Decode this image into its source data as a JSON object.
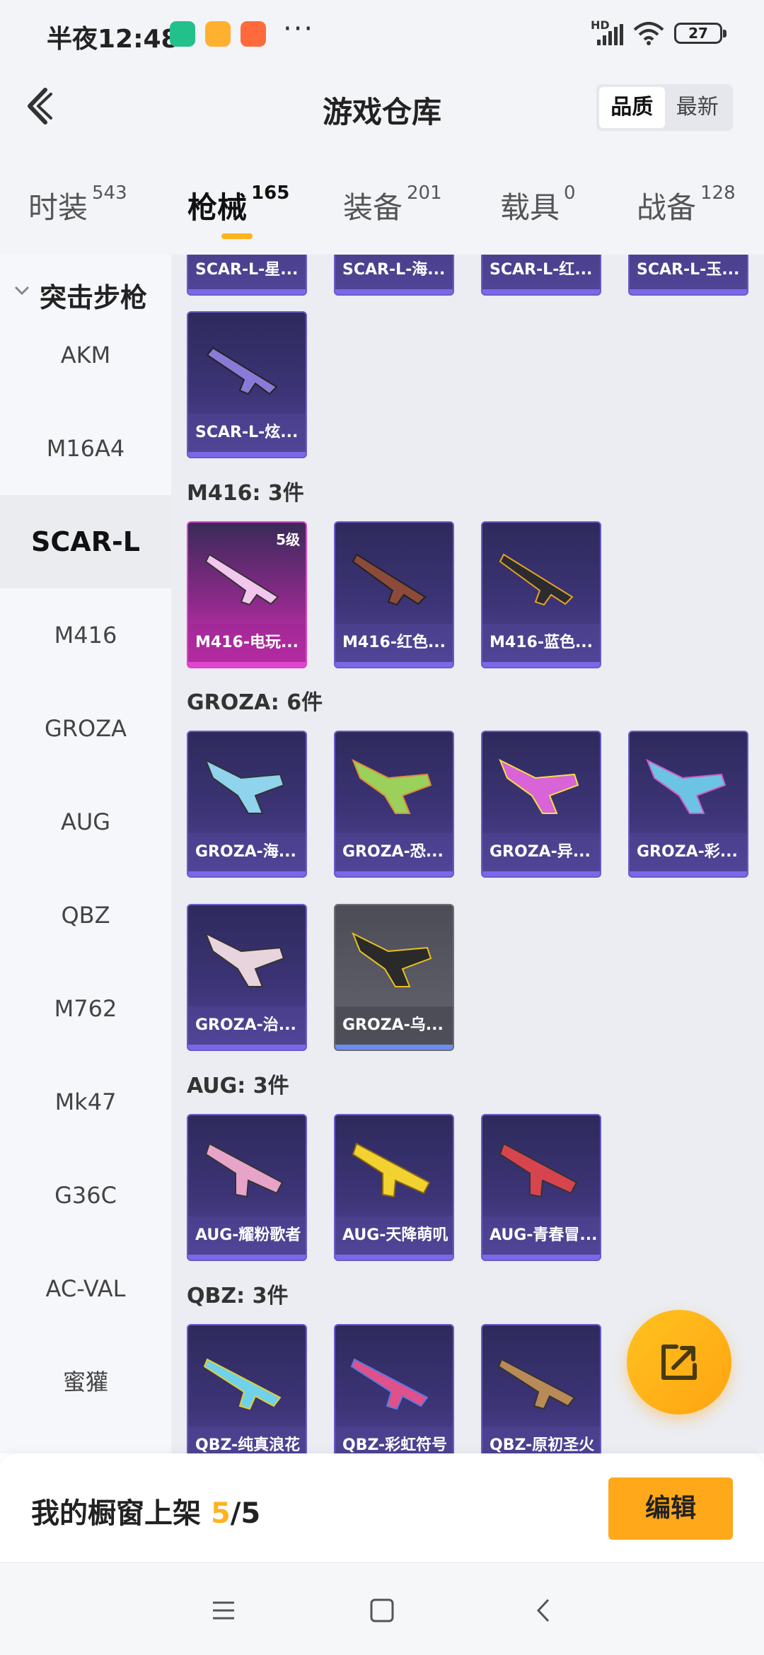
{
  "status_bar": {
    "time": "半夜12:48",
    "more": "···",
    "network_label": "HD",
    "battery": "27",
    "app_icons": [
      {
        "name": "shield-app-icon",
        "color": "#22c08a"
      },
      {
        "name": "note-app-icon",
        "color": "#ffb02e"
      },
      {
        "name": "shop-app-icon",
        "color": "#ff6a3d"
      }
    ]
  },
  "header": {
    "title": "游戏仓库",
    "sort_options": [
      "品质",
      "最新"
    ],
    "sort_active": "品质"
  },
  "category_tabs": [
    {
      "label": "时装",
      "count": "543"
    },
    {
      "label": "枪械",
      "count": "165",
      "active": true
    },
    {
      "label": "装备",
      "count": "201"
    },
    {
      "label": "载具",
      "count": "0"
    },
    {
      "label": "战备",
      "count": "128"
    }
  ],
  "sidebar": {
    "group": "突击步枪",
    "items": [
      "AKM",
      "M16A4",
      "SCAR-L",
      "M416",
      "GROZA",
      "AUG",
      "QBZ",
      "M762",
      "Mk47",
      "G36C",
      "AC-VAL",
      "蜜獾"
    ],
    "active": "SCAR-L"
  },
  "content": {
    "partial_row": [
      "SCAR-L-星...",
      "SCAR-L-海...",
      "SCAR-L-红...",
      "SCAR-L-玉..."
    ],
    "scar_extra": [
      "SCAR-L-炫..."
    ],
    "sections": [
      {
        "label": "M416: 3件",
        "items": [
          {
            "name": "M416-电玩...",
            "level": "5级",
            "style": "pink"
          },
          {
            "name": "M416-红色..."
          },
          {
            "name": "M416-蓝色..."
          }
        ]
      },
      {
        "label": "GROZA: 6件",
        "items": [
          {
            "name": "GROZA-海..."
          },
          {
            "name": "GROZA-恐..."
          },
          {
            "name": "GROZA-异..."
          },
          {
            "name": "GROZA-彩..."
          },
          {
            "name": "GROZA-治..."
          },
          {
            "name": "GROZA-乌...",
            "style": "gray"
          }
        ]
      },
      {
        "label": "AUG: 3件",
        "items": [
          {
            "name": "AUG-耀粉歌者"
          },
          {
            "name": "AUG-天降萌叽"
          },
          {
            "name": "AUG-青春冒..."
          }
        ]
      },
      {
        "label": "QBZ: 3件",
        "items": [
          {
            "name": "QBZ-纯真浪花"
          },
          {
            "name": "QBZ-彩虹符号"
          },
          {
            "name": "QBZ-原初圣火"
          }
        ]
      }
    ]
  },
  "bottom_panel": {
    "label": "我的橱窗上架",
    "current": "5",
    "separator": "/",
    "total": "5",
    "edit_label": "编辑"
  },
  "colors": {
    "accent": "#ffb21c",
    "card_purple": "#3c3476",
    "card_pink": "#d82fb7",
    "card_gray": "#5b5b66"
  }
}
